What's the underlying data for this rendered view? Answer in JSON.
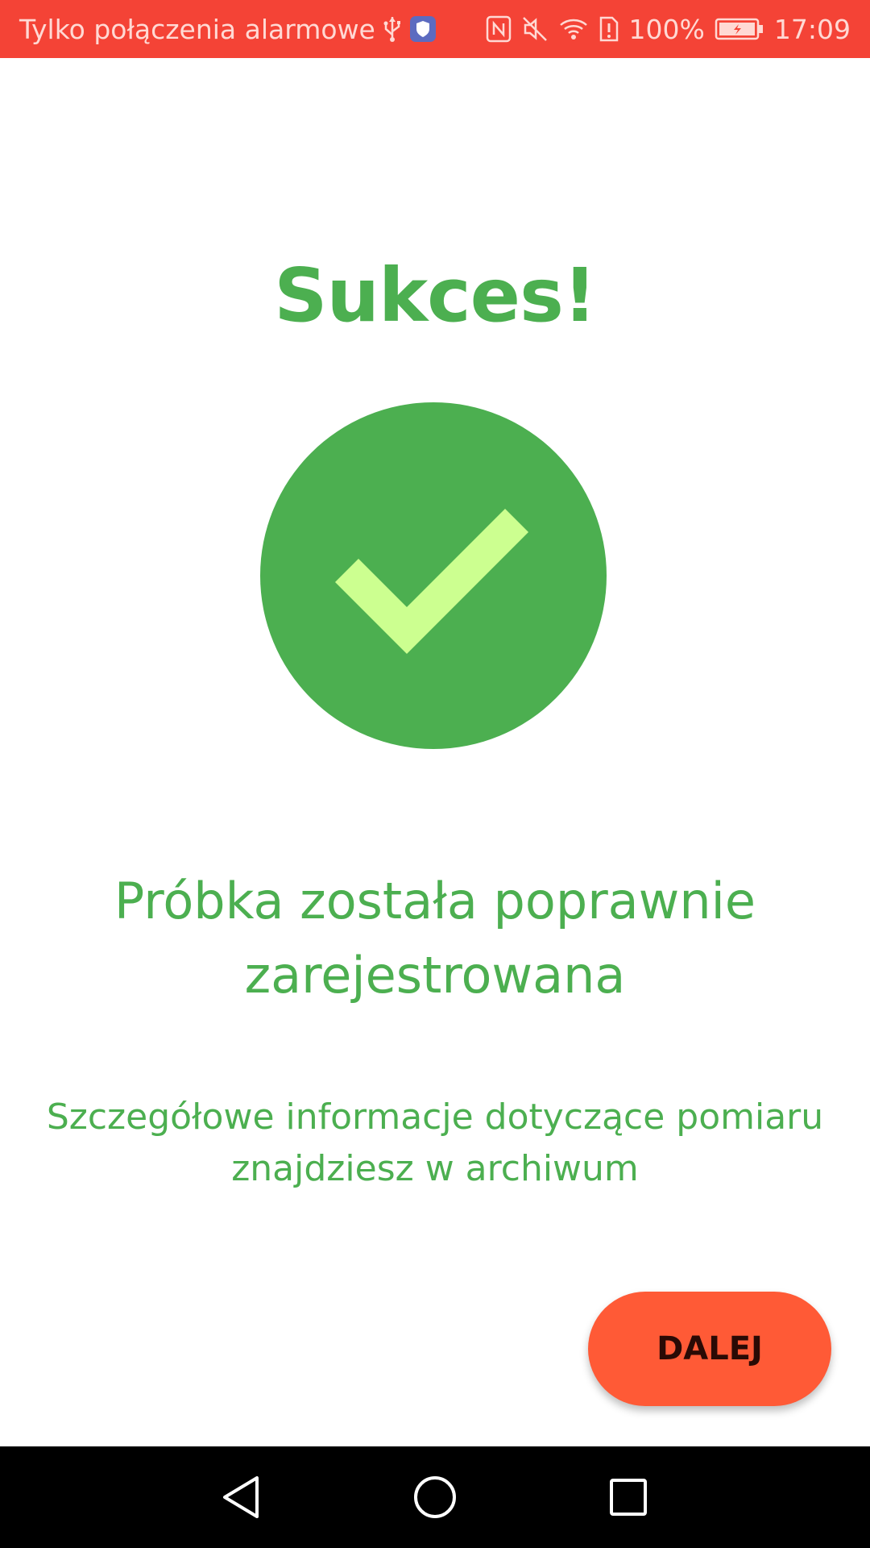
{
  "status_bar": {
    "carrier_text": "Tylko połączenia alarmowe",
    "battery_percent": "100%",
    "time": "17:09",
    "icons": [
      "usb-icon",
      "shield-icon",
      "nfc-icon",
      "mute-icon",
      "wifi-icon",
      "sim-alert-icon",
      "battery-charging-icon"
    ]
  },
  "main": {
    "title": "Sukces!",
    "message": "Próbka została poprawnie zarejestrowana",
    "details": "Szczegółowe informacje dotyczące pomiaru znajdziesz w archiwum",
    "next_button_label": "DALEJ"
  },
  "navigation": {
    "buttons": [
      "back-icon",
      "home-icon",
      "recents-icon"
    ]
  },
  "colors": {
    "status_bar": "#f44336",
    "success_green": "#4caf50",
    "check_mark": "#ccff90",
    "button": "#ff5a36",
    "nav_bar": "#000000"
  }
}
